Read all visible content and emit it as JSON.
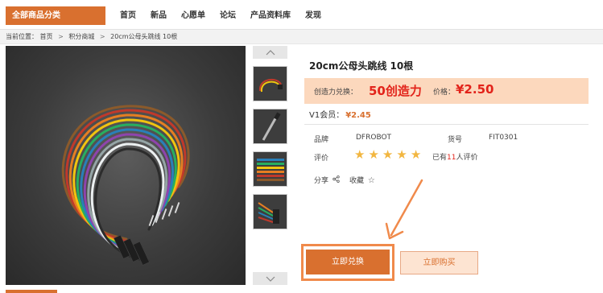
{
  "header": {
    "category_label": "全部商品分类",
    "nav": [
      "首页",
      "新品",
      "心愿单",
      "论坛",
      "产品资料库",
      "发现"
    ]
  },
  "breadcrumb": {
    "prefix": "当前位置：",
    "items": [
      "首页",
      "积分商城",
      "20cm公母头跳线 10根"
    ],
    "separator": ">"
  },
  "product": {
    "title": "20cm公母头跳线 10根",
    "credit_label": "创造力兑换：",
    "credit_value": "50创造力",
    "price_label": "价格：",
    "price_value": "¥2.50",
    "v1_label": "V1会员：",
    "v1_price": "¥2.45",
    "brand_label": "品牌",
    "brand_value": "DFROBOT",
    "sku_label": "货号",
    "sku_value": "FIT0301",
    "rating_label": "评价",
    "rating": 5,
    "review_prefix": "已有",
    "review_count": "11",
    "review_suffix": "人评价",
    "share_label": "分享",
    "collect_label": "收藏"
  },
  "actions": {
    "exchange_label": "立即兑换",
    "buy_label": "立即购买"
  },
  "thumbnails": {
    "up_icon": "chevron-up-icon",
    "down_icon": "chevron-down-icon",
    "count": 4
  },
  "colors": {
    "accent": "#d9702f",
    "price_red": "#e2231a",
    "price_band": "#fcd8bd",
    "star": "#f2b640",
    "highlight": "#f08a4b"
  }
}
